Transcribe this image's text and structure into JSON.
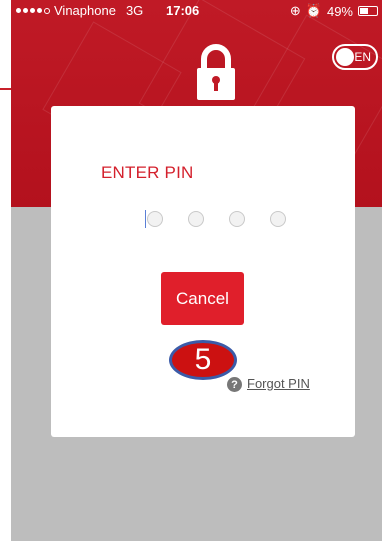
{
  "status_bar": {
    "carrier": "Vinaphone",
    "network": "3G",
    "time": "17:06",
    "battery_percent": "49%",
    "battery_level": 0.49
  },
  "language_toggle": {
    "label": "EN"
  },
  "pin_dialog": {
    "title": "ENTER PIN",
    "pin_slots": 4,
    "cancel_label": "Cancel",
    "help_glyph": "?",
    "forgot_label": "Forgot PIN"
  },
  "annotation": {
    "step_number": "5"
  },
  "colors": {
    "brand_red": "#c01a26",
    "button_red": "#e01f2b",
    "badge_border": "#3b5ba8"
  },
  "icons": [
    "lock-icon",
    "help-icon"
  ]
}
